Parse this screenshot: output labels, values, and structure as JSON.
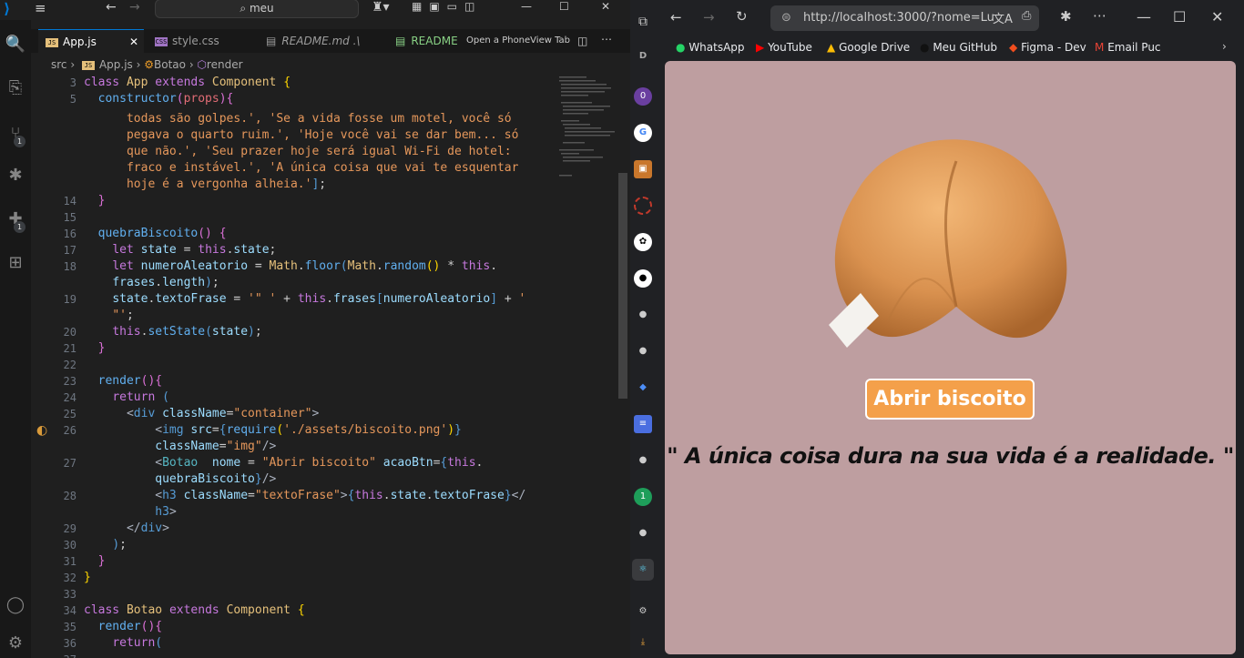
{
  "vscode": {
    "search": "meu",
    "tabs": [
      {
        "label": "App.js",
        "badge": "JS"
      },
      {
        "label": "style.css",
        "badge": "CSS"
      },
      {
        "label": "README.md .\\"
      },
      {
        "label": "README"
      },
      {
        "label": "Open a PhoneView Tab"
      }
    ],
    "breadcrumb": {
      "src": "src",
      "file": "App.js",
      "cls": "Botao",
      "method": "render"
    },
    "activity_badges": [
      "1",
      "1"
    ],
    "line_numbers": [
      "3",
      "5",
      "14",
      "15",
      "16",
      "17",
      "18",
      "19",
      "20",
      "21",
      "22",
      "23",
      "24",
      "25",
      "26",
      "27",
      "28",
      "29",
      "30",
      "31",
      "32",
      "33",
      "34",
      "35",
      "36",
      "37"
    ]
  },
  "browser": {
    "url": "http://localhost:3000/?nome=Lu",
    "bookmarks": [
      "WhatsApp",
      "YouTube",
      "Google Drive",
      "Meu GitHub",
      "Figma - Dev",
      "Email Puc"
    ],
    "sidebar_letter": "D",
    "button_label": "Abrir biscoito",
    "frase": "\" A única coisa dura na sua vida é a realidade. \""
  }
}
